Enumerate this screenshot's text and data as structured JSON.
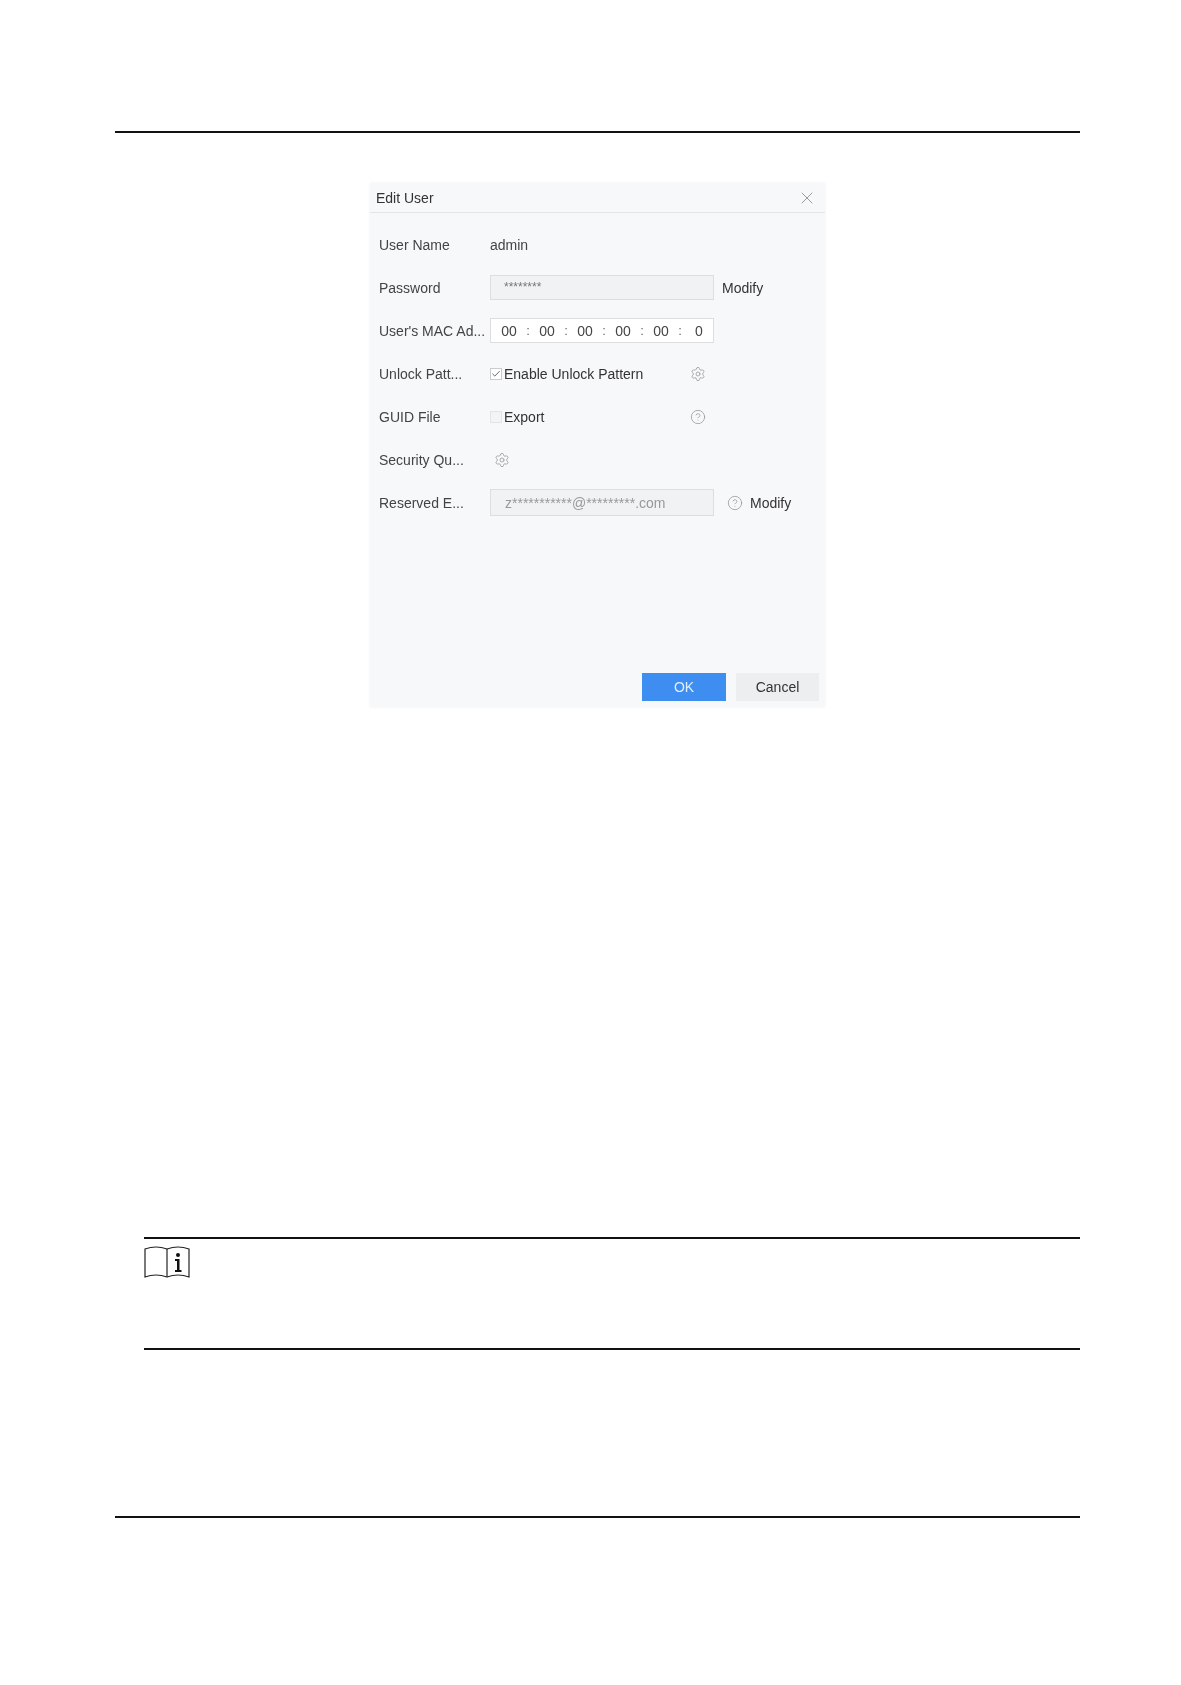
{
  "dialog": {
    "title": "Edit User",
    "fields": [
      {
        "kind": "plain",
        "label": "User Name",
        "value": "admin"
      },
      {
        "kind": "password",
        "label": "Password",
        "value": "********",
        "action": "Modify"
      },
      {
        "kind": "mac",
        "label": "User's MAC Ad...",
        "octets": [
          "00",
          "00",
          "00",
          "00",
          "00",
          "0"
        ],
        "separators": [
          ":",
          ":",
          ":",
          ":",
          ":"
        ]
      },
      {
        "kind": "pattern",
        "label": "Unlock Patt...",
        "option": "Enable Unlock Pattern",
        "checked": true
      },
      {
        "kind": "file",
        "label": "GUID File",
        "option": "Export",
        "checked": false
      },
      {
        "kind": "questions",
        "label": "Security Qu..."
      },
      {
        "kind": "email",
        "label": "Reserved E...",
        "value": "z***********@*********.com",
        "action": "Modify"
      }
    ],
    "buttons": [
      {
        "label": "OK",
        "primary": true
      },
      {
        "label": "Cancel",
        "primary": false
      }
    ]
  }
}
